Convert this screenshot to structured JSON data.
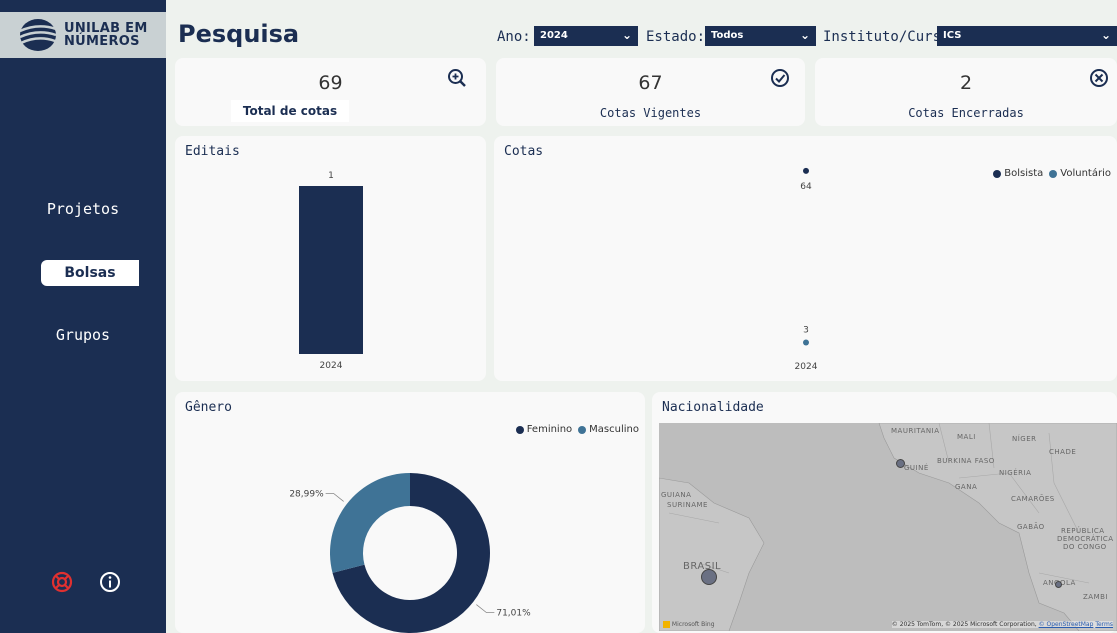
{
  "sidebar": {
    "logo_line1": "UNILAB EM",
    "logo_line2": "NÚMEROS",
    "items": [
      {
        "label": "Projetos",
        "active": false
      },
      {
        "label": "Bolsas",
        "active": true
      },
      {
        "label": "Grupos",
        "active": false
      }
    ],
    "bottom_icons": [
      "lifebuoy-icon",
      "info-icon"
    ]
  },
  "header": {
    "title": "Pesquisa",
    "filters": [
      {
        "label": "Ano:",
        "value": "2024"
      },
      {
        "label": "Estado:",
        "value": "Todos"
      },
      {
        "label": "Instituto/Curso:",
        "value": "ICS"
      }
    ]
  },
  "kpis": [
    {
      "value": "69",
      "label": "Total de cotas",
      "icon": "zoom-in-icon"
    },
    {
      "value": "67",
      "label": "Cotas Vigentes",
      "icon": "check-circle-icon"
    },
    {
      "value": "2",
      "label": "Cotas Encerradas",
      "icon": "close-circle-icon"
    }
  ],
  "panels": {
    "editais": "Editais",
    "cotas": "Cotas",
    "genero": "Gênero",
    "nacionalidade": "Nacionalidade"
  },
  "colors": {
    "navy": "#1b2e52",
    "steel": "#3f7396",
    "red": "#e03030"
  },
  "chart_data": [
    {
      "type": "bar",
      "title": "Editais",
      "categories": [
        "2024"
      ],
      "values": [
        1
      ],
      "data_labels": [
        "1"
      ]
    },
    {
      "type": "scatter",
      "title": "Cotas",
      "categories": [
        "2024"
      ],
      "legend_position": "top-right",
      "series": [
        {
          "name": "Bolsista",
          "values": [
            64
          ],
          "data_labels": [
            "64"
          ]
        },
        {
          "name": "Voluntário",
          "values": [
            3
          ],
          "data_labels": [
            "3"
          ]
        }
      ]
    },
    {
      "type": "pie",
      "title": "Gênero",
      "donut": true,
      "legend_position": "top-right",
      "categories": [
        "Feminino",
        "Masculino"
      ],
      "values": [
        71.01,
        28.99
      ],
      "data_labels": [
        "71,01%",
        "28,99%"
      ]
    }
  ],
  "map": {
    "labels": [
      "MAURITANIA",
      "MALI",
      "NÍGER",
      "CHADE",
      "BURKINA FASO",
      "GUINÉ",
      "NIGÉRIA",
      "GANA",
      "CAMARÕES",
      "GABÃO",
      "REPÚBLICA",
      "DEMOCRÁTICA",
      "DO CONGO",
      "GUIANA",
      "SURINAME",
      "BRASIL",
      "ANGOLA",
      "ZAMBI"
    ],
    "attribution": "© 2025 TomTom, © 2025 Microsoft Corporation,",
    "osm": "© OpenStreetMap",
    "terms": "Terms",
    "provider": "Microsoft Bing"
  }
}
